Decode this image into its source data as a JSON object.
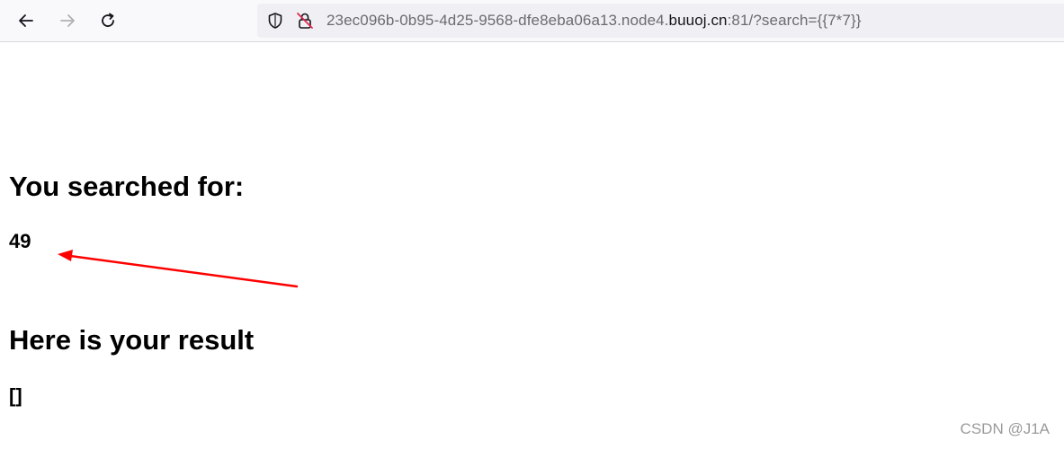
{
  "browser": {
    "url_prefix": "23ec096b-0b95-4d25-9568-dfe8eba06a13.node4.",
    "url_domain": "buuoj.cn",
    "url_suffix": ":81/?search={{7*7}}",
    "icons": {
      "back": "back-arrow-icon",
      "forward": "forward-arrow-icon",
      "reload": "reload-icon",
      "tracking": "shield-icon",
      "security": "insecure-lock-icon"
    }
  },
  "page": {
    "searched_heading": "You searched for:",
    "searched_value": "49",
    "result_heading": "Here is your result",
    "result_value": "[]"
  },
  "annotation": {
    "arrow_color": "#ff0000"
  },
  "watermark": "CSDN @J1A"
}
